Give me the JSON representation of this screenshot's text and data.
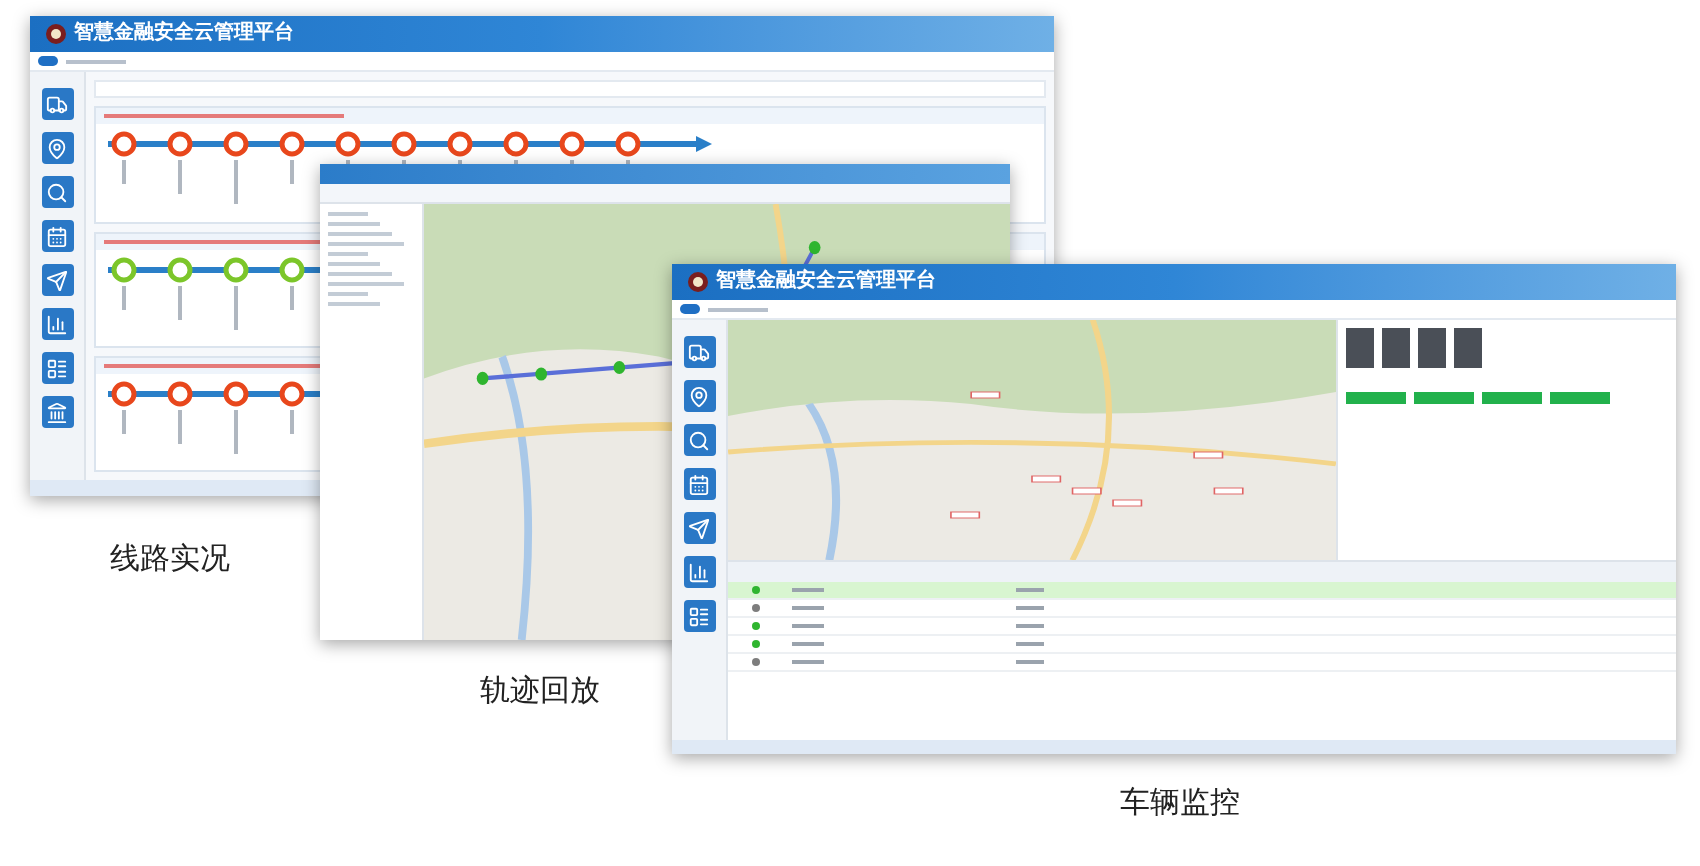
{
  "windows": [
    {
      "kind": "lines",
      "title": "智慧金融安全云管理平台",
      "toggle_on": true,
      "routes": [
        {
          "color": "#e8471c"
        },
        {
          "color": "#7cc62a"
        },
        {
          "color": "#e8471c"
        }
      ]
    },
    {
      "kind": "track"
    },
    {
      "kind": "monitor",
      "title": "智慧金融安全云管理平台",
      "toggle_on": true,
      "rows": [
        {
          "online": true,
          "selected": true
        },
        {
          "online": false,
          "selected": false
        },
        {
          "online": true,
          "selected": false
        },
        {
          "online": true,
          "selected": false
        },
        {
          "online": false,
          "selected": false
        }
      ]
    }
  ],
  "captions": [
    "线路实况",
    "轨迹回放",
    "车辆监控"
  ]
}
